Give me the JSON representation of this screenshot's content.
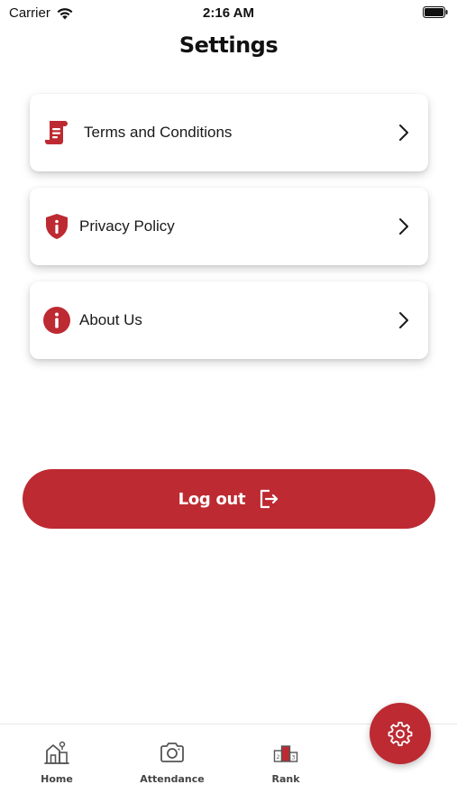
{
  "status_bar": {
    "carrier": "Carrier",
    "time": "2:16 AM",
    "icons": [
      "wifi-icon",
      "battery-icon"
    ]
  },
  "header": {
    "title": "Settings"
  },
  "settings": {
    "items": [
      {
        "label": "Terms and Conditions",
        "icon": "document-icon"
      },
      {
        "label": "Privacy Policy",
        "icon": "shield-icon"
      },
      {
        "label": "About Us",
        "icon": "info-icon"
      }
    ]
  },
  "logout": {
    "label": "Log out",
    "icon": "logout-icon"
  },
  "tab_bar": {
    "tabs": [
      {
        "label": "Home",
        "icon": "home-icon"
      },
      {
        "label": "Attendance",
        "icon": "camera-icon"
      },
      {
        "label": "Rank",
        "icon": "podium-icon"
      }
    ],
    "active_fab_icon": "gear-icon"
  },
  "colors": {
    "accent": "#bd2a32",
    "text": "#1a1a1a",
    "tab_text": "#444444"
  }
}
